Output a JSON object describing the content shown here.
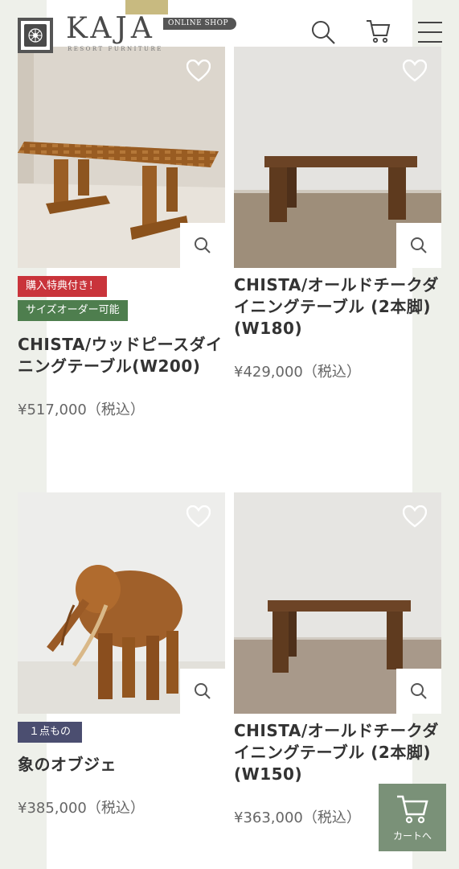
{
  "header": {
    "brand": "KAJA",
    "brand_sub": "RESORT FURNITURE",
    "shop_badge": "ONLINE SHOP",
    "icons": [
      "search-icon",
      "cart-icon",
      "menu-icon"
    ]
  },
  "products": [
    {
      "tags": [
        "購入特典付き！",
        "サイズオーダー可能"
      ],
      "name": "CHISTA/ウッドピースダイニングテーブル(W200)",
      "price": "¥517,000（税込）"
    },
    {
      "tags": [],
      "name": "CHISTA/オールドチークダイニングテーブル (2本脚) (W180)",
      "price": "¥429,000（税込）"
    },
    {
      "tags": [
        "１点もの"
      ],
      "name": "象のオブジェ",
      "price": "¥385,000（税込）"
    },
    {
      "tags": [],
      "name": "CHISTA/オールドチークダイニングテーブル (2本脚) (W150)",
      "price": "¥363,000（税込）"
    }
  ],
  "cart_button": {
    "label": "カートへ"
  },
  "colors": {
    "tag_red": "#c9343b",
    "tag_green": "#4e7e4e",
    "tag_navy": "#4b4e70",
    "cart_button": "#7a9178"
  }
}
